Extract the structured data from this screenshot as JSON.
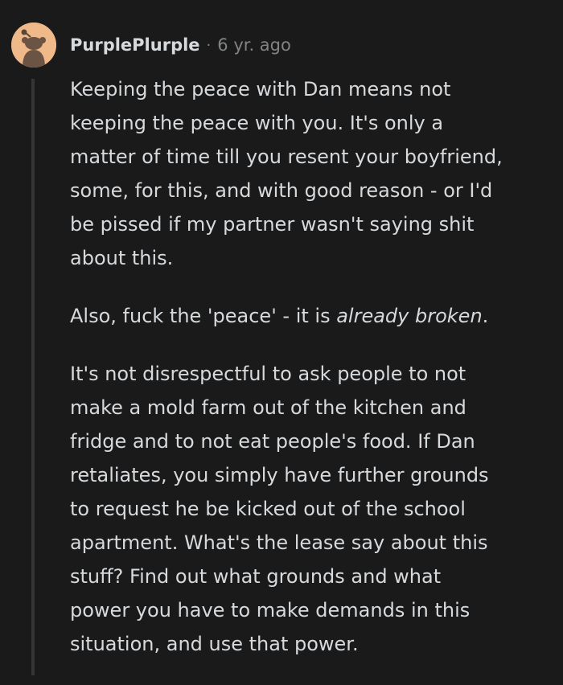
{
  "comment": {
    "author": "PurplePlurple",
    "separator": "·",
    "time_ago": "6 yr. ago",
    "avatar_icon": "snoo-avatar-icon",
    "colors": {
      "background": "#1a1a1b",
      "text": "#d7dadc",
      "meta": "#818384",
      "avatar_bg": "#f0b98a",
      "thread_line": "#343536"
    },
    "paragraph_1": [
      "Keeping the peace with Dan means not",
      "keeping the peace with you. It's only a",
      "matter of time till you resent your boyfriend,",
      "some, for this, and with good reason - or I'd",
      "be pissed if my partner wasn't saying shit",
      "about this."
    ],
    "paragraph_2": {
      "before": "Also, fuck the 'peace' - it is ",
      "emphasis": "already broken",
      "after": "."
    },
    "paragraph_3": [
      "It's not disrespectful to ask people to not",
      "make a mold farm out of the kitchen and",
      "fridge and to not eat people's food. If Dan",
      "retaliates, you simply have further grounds",
      "to request he be kicked out of the school",
      "apartment. What's the lease say about this",
      "stuff? Find out what grounds and what",
      "power you have to make demands in this",
      "situation, and use that power."
    ]
  }
}
